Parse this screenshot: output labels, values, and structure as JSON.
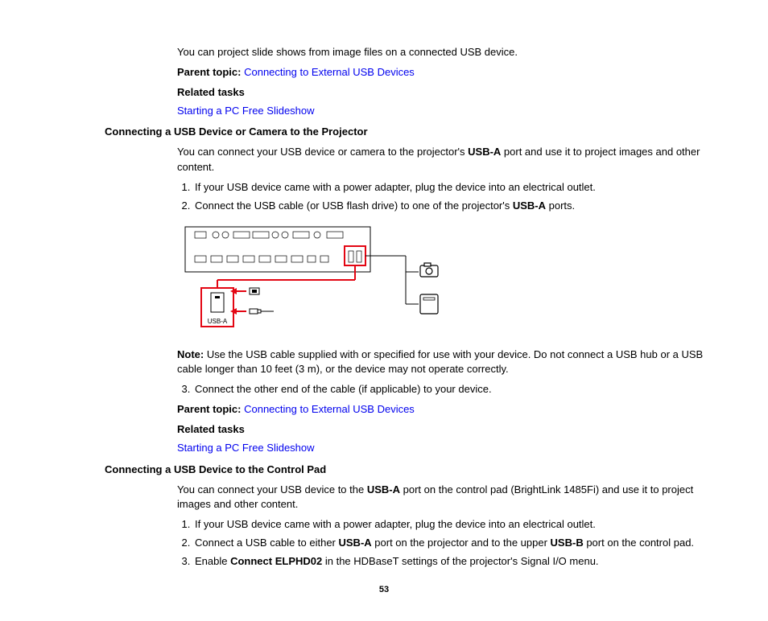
{
  "intro_para": "You can project slide shows from image files on a connected USB device.",
  "parent_topic_label": "Parent topic:",
  "parent_topic_link": "Connecting to External USB Devices",
  "related_tasks_label": "Related tasks",
  "related_tasks_link": "Starting a PC Free Slideshow",
  "section1": {
    "heading": "Connecting a USB Device or Camera to the Projector",
    "p1_a": "You can connect your USB device or camera to the projector's ",
    "p1_b": "USB-A",
    "p1_c": " port and use it to project images and other content.",
    "li1": "If your USB device came with a power adapter, plug the device into an electrical outlet.",
    "li2_a": "Connect the USB cable (or USB flash drive) to one of the projector's ",
    "li2_b": "USB-A",
    "li2_c": " ports.",
    "note_label": "Note:",
    "note_text": " Use the USB cable supplied with or specified for use with your device. Do not connect a USB hub or a USB cable longer than 10 feet (3 m), or the device may not operate correctly.",
    "li3": "Connect the other end of the cable (if applicable) to your device."
  },
  "section2": {
    "heading": "Connecting a USB Device to the Control Pad",
    "p1_a": "You can connect your USB device to the ",
    "p1_b": "USB-A",
    "p1_c": " port on the control pad (BrightLink 1485Fi) and use it to project images and other content.",
    "li1": "If your USB device came with a power adapter, plug the device into an electrical outlet.",
    "li2_a": "Connect a USB cable to either ",
    "li2_b": "USB-A",
    "li2_c": " port on the projector and to the upper ",
    "li2_d": "USB-B",
    "li2_e": " port on the control pad.",
    "li3_a": "Enable ",
    "li3_b": "Connect ELPHD02",
    "li3_c": " in the HDBaseT settings of the projector's Signal I/O menu."
  },
  "diagram_label": "USB-A",
  "page_number": "53"
}
